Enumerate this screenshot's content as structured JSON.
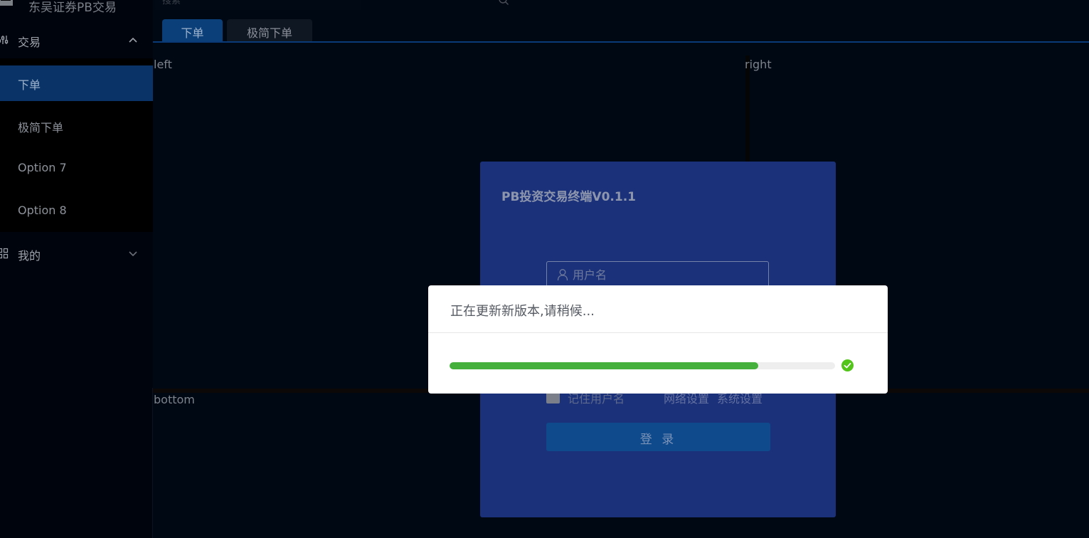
{
  "app": {
    "title": "东吴证券PB交易"
  },
  "search": {
    "placeholder": "搜索"
  },
  "sidebar": {
    "group_trade": {
      "label": "交易",
      "icon": "sliders-icon",
      "expanded": true
    },
    "items": [
      {
        "label": "下单",
        "active": true
      },
      {
        "label": "极简下单",
        "active": false
      },
      {
        "label": "Option 7",
        "active": false
      },
      {
        "label": "Option 8",
        "active": false
      }
    ],
    "group_mine": {
      "label": "我的",
      "icon": "grid-icon",
      "expanded": false
    }
  },
  "tabs": [
    {
      "label": "下单",
      "active": true
    },
    {
      "label": "极简下单",
      "active": false
    }
  ],
  "panes": {
    "left": "left",
    "right": "right",
    "bottom": "bottom"
  },
  "login": {
    "title": "PB投资交易终端V0.1.1",
    "username_placeholder": "用户名",
    "remember_label": "记住用户名",
    "network_settings": "网络设置",
    "system_settings": "系统设置",
    "login_button": "登 录"
  },
  "update_dialog": {
    "message": "正在更新新版本,请稍候...",
    "progress": 0.8,
    "status": "success"
  },
  "colors": {
    "accent": "#0a3368",
    "login_card": "#1b327b",
    "progress": "#45b03c",
    "success": "#52c41a"
  }
}
